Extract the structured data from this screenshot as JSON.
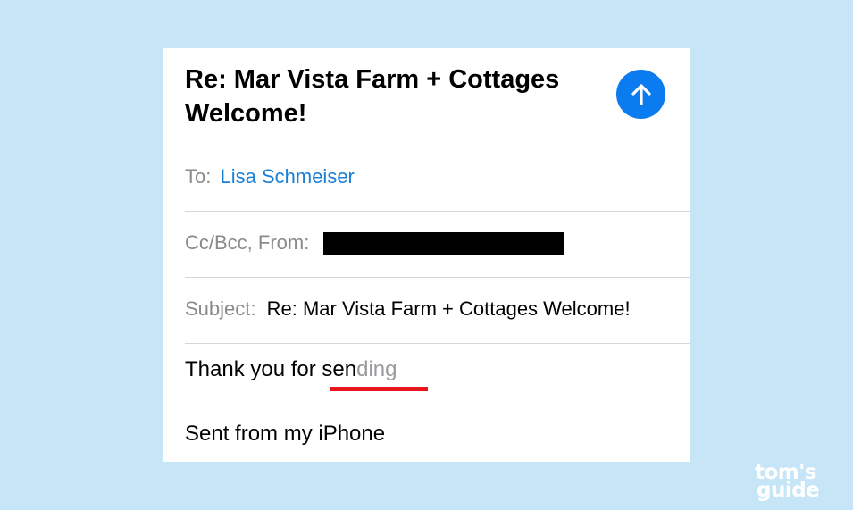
{
  "email": {
    "title": "Re: Mar Vista Farm + Cottages Welcome!",
    "to_label": "To:",
    "to_value": "Lisa Schmeiser",
    "ccbcc_label": "Cc/Bcc, From:",
    "subject_label": "Subject:",
    "subject_value": "Re: Mar Vista Farm + Cottages Welcome!",
    "body": {
      "typed_text": "Thank you for sen",
      "suggestion_text": "ding"
    },
    "signature": "Sent from my iPhone"
  },
  "send_button": {
    "icon": "arrow-up-icon",
    "color": "#0a7cf0"
  },
  "watermark": {
    "line1": "tom's",
    "line2": "guide"
  },
  "colors": {
    "background": "#c6e6f8",
    "link": "#1a7fd6",
    "label_gray": "#8a8a8e",
    "highlight_underline": "#e8141e"
  }
}
